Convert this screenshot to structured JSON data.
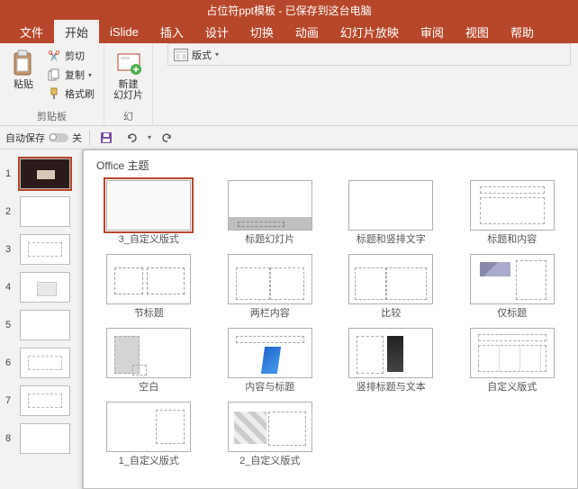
{
  "titlebar": {
    "text": "占位符ppt模板 - 已保存到这台电脑"
  },
  "tabs": {
    "items": [
      "文件",
      "开始",
      "iSlide",
      "插入",
      "设计",
      "切换",
      "动画",
      "幻灯片放映",
      "审阅",
      "视图",
      "帮助"
    ],
    "active_index": 1
  },
  "ribbon": {
    "clipboard": {
      "paste": "粘贴",
      "cut": "剪切",
      "copy": "复制",
      "format_painter": "格式刷",
      "group_label": "剪贴板"
    },
    "slides": {
      "new_slide": "新建\n幻灯片",
      "layout": "版式",
      "group_label": "幻"
    }
  },
  "qat": {
    "autosave_label": "自动保存",
    "autosave_off": "关"
  },
  "slide_panel": {
    "slides": [
      1,
      2,
      3,
      4,
      5,
      6,
      7,
      8
    ],
    "selected": 1
  },
  "gallery": {
    "title": "Office 主题",
    "layouts": [
      {
        "label": "3_自定义版式",
        "cls": "p-blank",
        "sel": true
      },
      {
        "label": "标题幻灯片",
        "cls": "p-titlebar"
      },
      {
        "label": "标题和竖排文字",
        "cls": "p-diag"
      },
      {
        "label": "标题和内容",
        "cls": "p-titlecontent"
      },
      {
        "label": "节标题",
        "cls": "p-section"
      },
      {
        "label": "两栏内容",
        "cls": "p-twocol"
      },
      {
        "label": "比较",
        "cls": "p-compare"
      },
      {
        "label": "仅标题",
        "cls": "p-titleonly"
      },
      {
        "label": "空白",
        "cls": "p-empty2 p-empty"
      },
      {
        "label": "内容与标题",
        "cls": "p-contenttitle"
      },
      {
        "label": "竖排标题与文本",
        "cls": "p-vertical"
      },
      {
        "label": "自定义版式",
        "cls": "p-custom4"
      },
      {
        "label": "1_自定义版式",
        "cls": "p-diag2"
      },
      {
        "label": "2_自定义版式",
        "cls": "p-diamond"
      }
    ]
  }
}
